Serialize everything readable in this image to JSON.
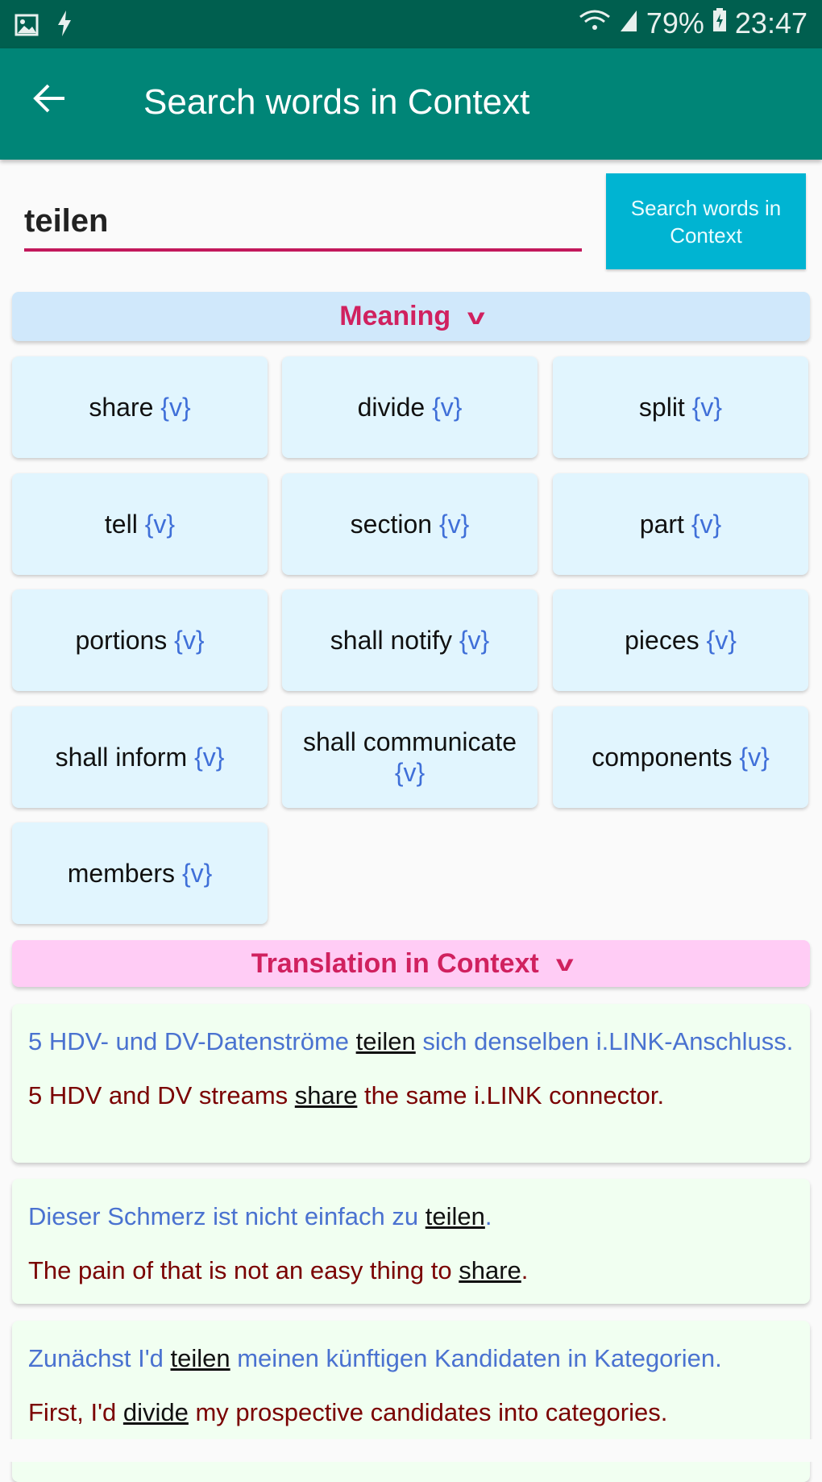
{
  "status_bar": {
    "icons": [
      "image-icon",
      "flash-icon",
      "wifi-icon",
      "signal-icon",
      "battery-charging-icon"
    ],
    "battery": "79%",
    "time": "23:47"
  },
  "app_bar": {
    "title": "Search words in Context",
    "back_icon": "arrow-left-icon"
  },
  "search": {
    "value": "teilen",
    "button_label": "Search words in Context"
  },
  "meaning": {
    "header": "Meaning",
    "items": [
      {
        "word": "share",
        "pos": "{v}"
      },
      {
        "word": "divide",
        "pos": "{v}"
      },
      {
        "word": "split",
        "pos": "{v}"
      },
      {
        "word": "tell",
        "pos": "{v}"
      },
      {
        "word": "section",
        "pos": "{v}"
      },
      {
        "word": "part",
        "pos": "{v}"
      },
      {
        "word": "portions",
        "pos": "{v}"
      },
      {
        "word": "shall notify",
        "pos": "{v}"
      },
      {
        "word": "pieces",
        "pos": "{v}"
      },
      {
        "word": "shall inform",
        "pos": "{v}"
      },
      {
        "word": "shall communicate",
        "pos": "{v}"
      },
      {
        "word": "components",
        "pos": "{v}"
      },
      {
        "word": "members",
        "pos": "{v}"
      }
    ]
  },
  "translation": {
    "header": "Translation in Context",
    "examples": [
      {
        "de": [
          "5 HDV- und DV-Datenströme ",
          "teilen",
          " sich denselben i.LINK-Anschluss."
        ],
        "en": [
          "5 HDV and DV streams ",
          "share",
          " the same i.LINK connector."
        ]
      },
      {
        "de": [
          "Dieser Schmerz ist nicht einfach zu ",
          "teilen",
          "."
        ],
        "en": [
          "The pain of that is not an easy thing to ",
          "share",
          "."
        ]
      },
      {
        "de": [
          "Zunächst I'd ",
          "teilen",
          " meinen künftigen Kandidaten in Kategorien."
        ],
        "en": [
          "First, I'd ",
          "divide",
          " my prospective candidates into categories."
        ]
      }
    ]
  },
  "colors": {
    "status_bar": "#005f4f",
    "app_bar": "#008577",
    "accent": "#c2185b",
    "button": "#00b4d2",
    "meaning_header": "#d0e8fb",
    "translation_header": "#ffccf5",
    "tile": "#e1f5fe",
    "card": "#f1fff1",
    "german": "#4a72d0",
    "english": "#7a0000"
  }
}
